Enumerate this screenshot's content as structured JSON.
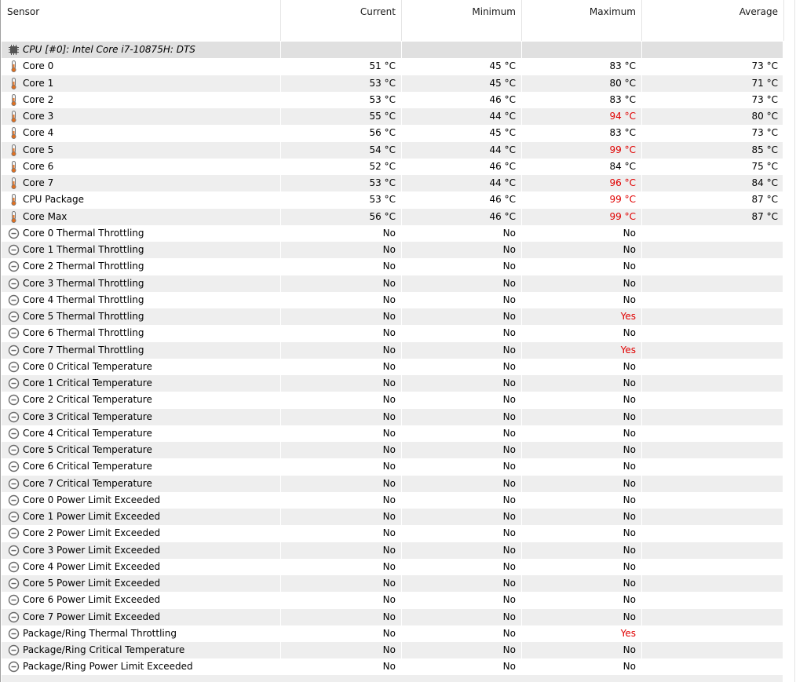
{
  "columns": {
    "sensor": "Sensor",
    "current": "Current",
    "minimum": "Minimum",
    "maximum": "Maximum",
    "average": "Average"
  },
  "colors": {
    "alert": "#e00000",
    "row_shade": "#eeeeee",
    "group_shade": "#e0e0e0"
  },
  "group": {
    "icon": "chip-icon",
    "label": "CPU [#0]: Intel Core i7-10875H: DTS"
  },
  "rows": [
    {
      "icon": "thermometer-icon",
      "name": "Core 0",
      "current": "51 °C",
      "minimum": "45 °C",
      "maximum": "83 °C",
      "average": "73 °C",
      "max_alert": false
    },
    {
      "icon": "thermometer-icon",
      "name": "Core 1",
      "current": "53 °C",
      "minimum": "45 °C",
      "maximum": "80 °C",
      "average": "71 °C",
      "max_alert": false
    },
    {
      "icon": "thermometer-icon",
      "name": "Core 2",
      "current": "53 °C",
      "minimum": "46 °C",
      "maximum": "83 °C",
      "average": "73 °C",
      "max_alert": false
    },
    {
      "icon": "thermometer-icon",
      "name": "Core 3",
      "current": "55 °C",
      "minimum": "44 °C",
      "maximum": "94 °C",
      "average": "80 °C",
      "max_alert": true
    },
    {
      "icon": "thermometer-icon",
      "name": "Core 4",
      "current": "56 °C",
      "minimum": "45 °C",
      "maximum": "83 °C",
      "average": "73 °C",
      "max_alert": false
    },
    {
      "icon": "thermometer-icon",
      "name": "Core 5",
      "current": "54 °C",
      "minimum": "44 °C",
      "maximum": "99 °C",
      "average": "85 °C",
      "max_alert": true
    },
    {
      "icon": "thermometer-icon",
      "name": "Core 6",
      "current": "52 °C",
      "minimum": "46 °C",
      "maximum": "84 °C",
      "average": "75 °C",
      "max_alert": false
    },
    {
      "icon": "thermometer-icon",
      "name": "Core 7",
      "current": "53 °C",
      "minimum": "44 °C",
      "maximum": "96 °C",
      "average": "84 °C",
      "max_alert": true
    },
    {
      "icon": "thermometer-icon",
      "name": "CPU Package",
      "current": "53 °C",
      "minimum": "46 °C",
      "maximum": "99 °C",
      "average": "87 °C",
      "max_alert": true
    },
    {
      "icon": "thermometer-icon",
      "name": "Core Max",
      "current": "56 °C",
      "minimum": "46 °C",
      "maximum": "99 °C",
      "average": "87 °C",
      "max_alert": true
    },
    {
      "icon": "status-icon",
      "name": "Core 0 Thermal Throttling",
      "current": "No",
      "minimum": "No",
      "maximum": "No",
      "average": "",
      "max_alert": false
    },
    {
      "icon": "status-icon",
      "name": "Core 1 Thermal Throttling",
      "current": "No",
      "minimum": "No",
      "maximum": "No",
      "average": "",
      "max_alert": false
    },
    {
      "icon": "status-icon",
      "name": "Core 2 Thermal Throttling",
      "current": "No",
      "minimum": "No",
      "maximum": "No",
      "average": "",
      "max_alert": false
    },
    {
      "icon": "status-icon",
      "name": "Core 3 Thermal Throttling",
      "current": "No",
      "minimum": "No",
      "maximum": "No",
      "average": "",
      "max_alert": false
    },
    {
      "icon": "status-icon",
      "name": "Core 4 Thermal Throttling",
      "current": "No",
      "minimum": "No",
      "maximum": "No",
      "average": "",
      "max_alert": false
    },
    {
      "icon": "status-icon",
      "name": "Core 5 Thermal Throttling",
      "current": "No",
      "minimum": "No",
      "maximum": "Yes",
      "average": "",
      "max_alert": true
    },
    {
      "icon": "status-icon",
      "name": "Core 6 Thermal Throttling",
      "current": "No",
      "minimum": "No",
      "maximum": "No",
      "average": "",
      "max_alert": false
    },
    {
      "icon": "status-icon",
      "name": "Core 7 Thermal Throttling",
      "current": "No",
      "minimum": "No",
      "maximum": "Yes",
      "average": "",
      "max_alert": true
    },
    {
      "icon": "status-icon",
      "name": "Core 0 Critical Temperature",
      "current": "No",
      "minimum": "No",
      "maximum": "No",
      "average": "",
      "max_alert": false
    },
    {
      "icon": "status-icon",
      "name": "Core 1 Critical Temperature",
      "current": "No",
      "minimum": "No",
      "maximum": "No",
      "average": "",
      "max_alert": false
    },
    {
      "icon": "status-icon",
      "name": "Core 2 Critical Temperature",
      "current": "No",
      "minimum": "No",
      "maximum": "No",
      "average": "",
      "max_alert": false
    },
    {
      "icon": "status-icon",
      "name": "Core 3 Critical Temperature",
      "current": "No",
      "minimum": "No",
      "maximum": "No",
      "average": "",
      "max_alert": false
    },
    {
      "icon": "status-icon",
      "name": "Core 4 Critical Temperature",
      "current": "No",
      "minimum": "No",
      "maximum": "No",
      "average": "",
      "max_alert": false
    },
    {
      "icon": "status-icon",
      "name": "Core 5 Critical Temperature",
      "current": "No",
      "minimum": "No",
      "maximum": "No",
      "average": "",
      "max_alert": false
    },
    {
      "icon": "status-icon",
      "name": "Core 6 Critical Temperature",
      "current": "No",
      "minimum": "No",
      "maximum": "No",
      "average": "",
      "max_alert": false
    },
    {
      "icon": "status-icon",
      "name": "Core 7 Critical Temperature",
      "current": "No",
      "minimum": "No",
      "maximum": "No",
      "average": "",
      "max_alert": false
    },
    {
      "icon": "status-icon",
      "name": "Core 0 Power Limit Exceeded",
      "current": "No",
      "minimum": "No",
      "maximum": "No",
      "average": "",
      "max_alert": false
    },
    {
      "icon": "status-icon",
      "name": "Core 1 Power Limit Exceeded",
      "current": "No",
      "minimum": "No",
      "maximum": "No",
      "average": "",
      "max_alert": false
    },
    {
      "icon": "status-icon",
      "name": "Core 2 Power Limit Exceeded",
      "current": "No",
      "minimum": "No",
      "maximum": "No",
      "average": "",
      "max_alert": false
    },
    {
      "icon": "status-icon",
      "name": "Core 3 Power Limit Exceeded",
      "current": "No",
      "minimum": "No",
      "maximum": "No",
      "average": "",
      "max_alert": false
    },
    {
      "icon": "status-icon",
      "name": "Core 4 Power Limit Exceeded",
      "current": "No",
      "minimum": "No",
      "maximum": "No",
      "average": "",
      "max_alert": false
    },
    {
      "icon": "status-icon",
      "name": "Core 5 Power Limit Exceeded",
      "current": "No",
      "minimum": "No",
      "maximum": "No",
      "average": "",
      "max_alert": false
    },
    {
      "icon": "status-icon",
      "name": "Core 6 Power Limit Exceeded",
      "current": "No",
      "minimum": "No",
      "maximum": "No",
      "average": "",
      "max_alert": false
    },
    {
      "icon": "status-icon",
      "name": "Core 7 Power Limit Exceeded",
      "current": "No",
      "minimum": "No",
      "maximum": "No",
      "average": "",
      "max_alert": false
    },
    {
      "icon": "status-icon",
      "name": "Package/Ring Thermal Throttling",
      "current": "No",
      "minimum": "No",
      "maximum": "Yes",
      "average": "",
      "max_alert": true
    },
    {
      "icon": "status-icon",
      "name": "Package/Ring Critical Temperature",
      "current": "No",
      "minimum": "No",
      "maximum": "No",
      "average": "",
      "max_alert": false
    },
    {
      "icon": "status-icon",
      "name": "Package/Ring Power Limit Exceeded",
      "current": "No",
      "minimum": "No",
      "maximum": "No",
      "average": "",
      "max_alert": false
    }
  ]
}
